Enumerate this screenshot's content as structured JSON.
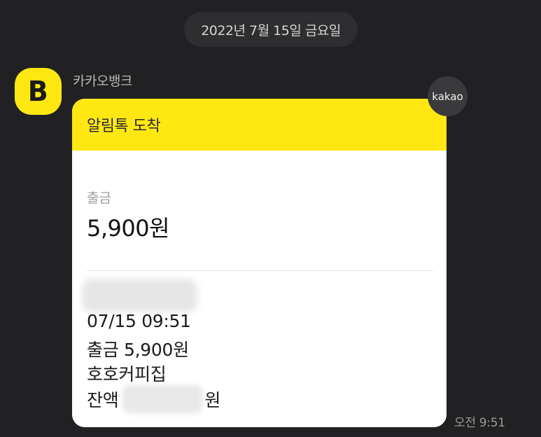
{
  "chat": {
    "date_separator": "2022년 7월 15일 금요일",
    "sender_name": "카카오뱅크",
    "avatar_letter": "B",
    "channel_badge": "kakao",
    "timestamp": "오전 9:51"
  },
  "card": {
    "header_title": "알림톡 도착",
    "type_label": "출금",
    "amount": "5,900원",
    "details": {
      "datetime": "07/15 09:51",
      "withdrawal": "출금 5,900원",
      "merchant": "호호커피집",
      "balance_label": "잔액",
      "balance_unit": "원"
    }
  },
  "colors": {
    "background": "#212123",
    "accent_yellow": "#ffe812",
    "card_background": "#ffffff"
  }
}
